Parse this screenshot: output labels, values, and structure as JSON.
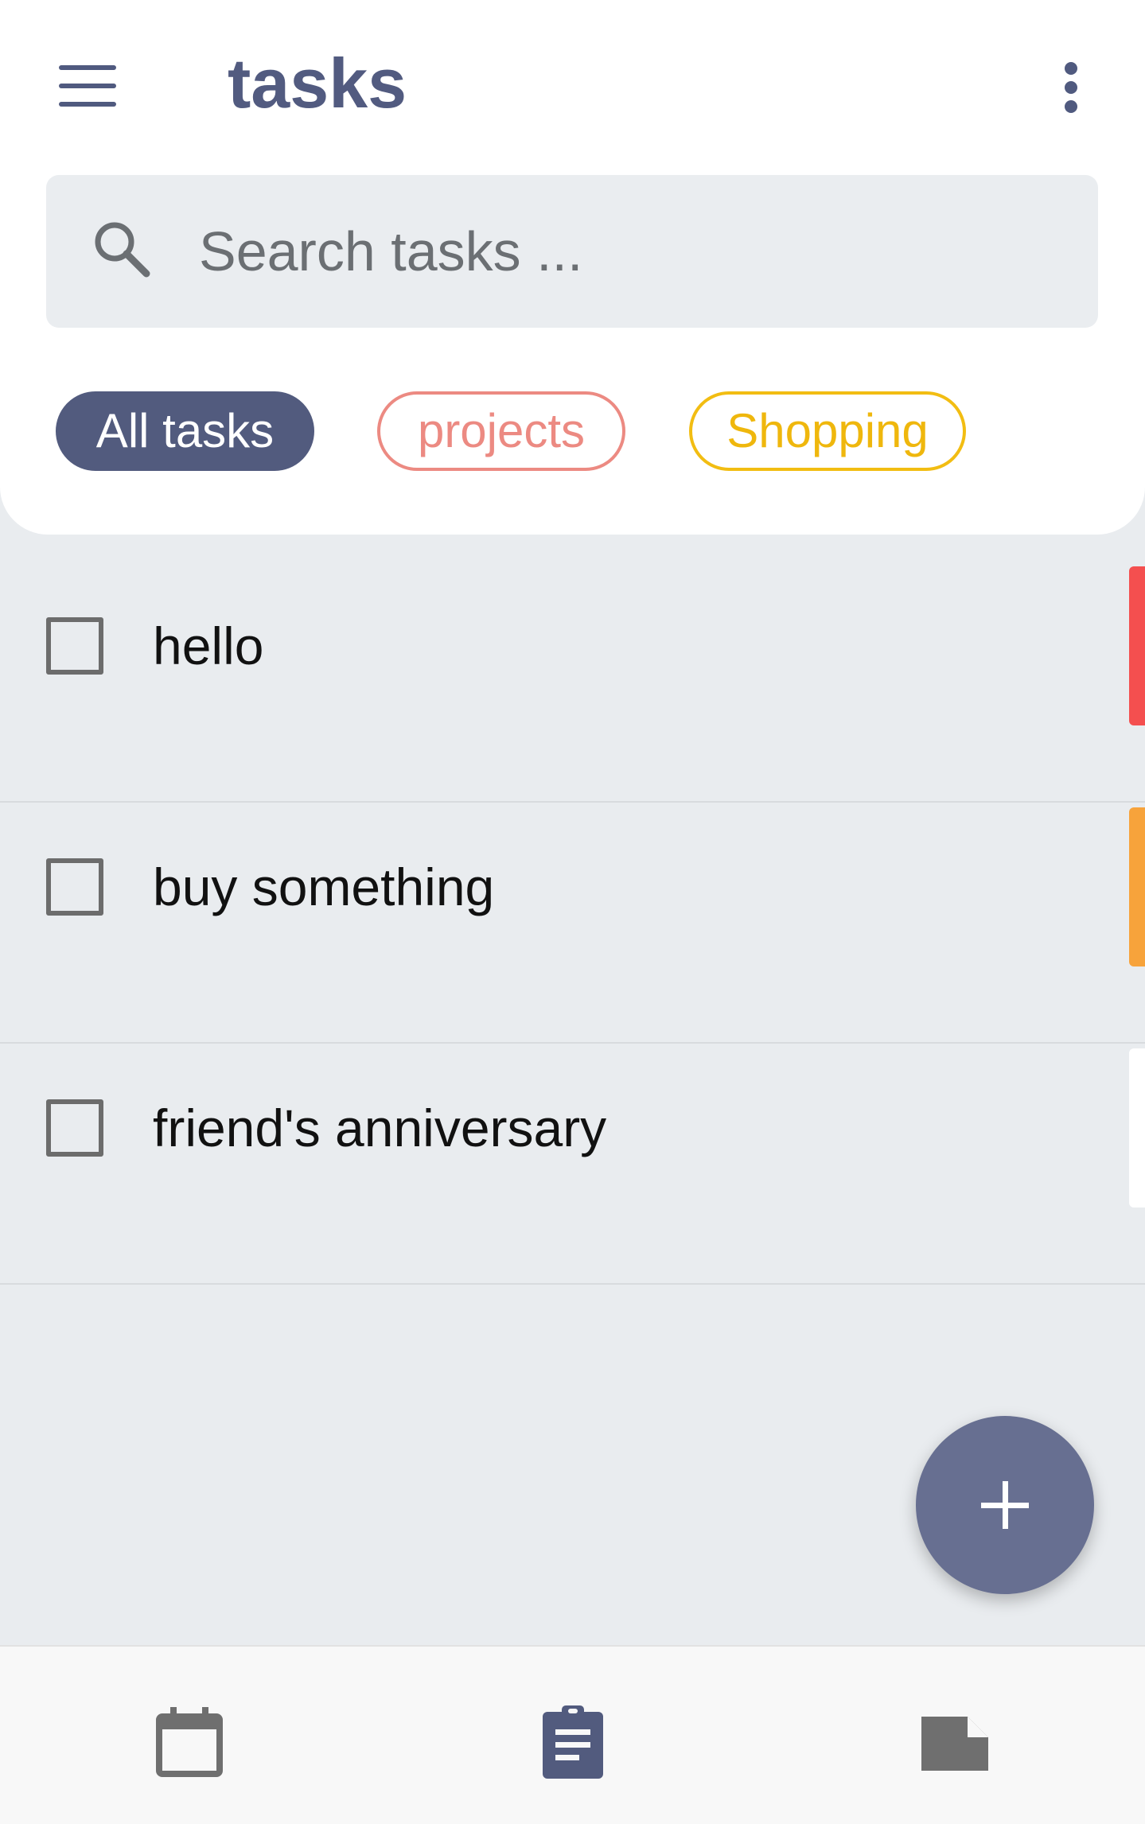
{
  "header": {
    "title": "tasks",
    "menu_icon": "hamburger-menu-icon",
    "more_icon": "more-vertical-icon"
  },
  "search": {
    "placeholder": "Search tasks ...",
    "value": "",
    "icon": "search-icon"
  },
  "filters": [
    {
      "label": "All tasks",
      "selected": true,
      "color": "#525b7e"
    },
    {
      "label": "projects",
      "selected": false,
      "color": "#ec8a82"
    },
    {
      "label": "Shopping",
      "selected": false,
      "color": "#f2bd12"
    }
  ],
  "tasks": [
    {
      "label": "hello",
      "checked": false,
      "priority_color": "#f44f4f"
    },
    {
      "label": "buy something",
      "checked": false,
      "priority_color": "#f7a33b"
    },
    {
      "label": "friend's anniversary",
      "checked": false,
      "priority_color": "#ffffff"
    }
  ],
  "fab": {
    "icon": "plus-icon"
  },
  "bottom_nav": [
    {
      "icon": "calendar-icon",
      "active": false
    },
    {
      "icon": "clipboard-list-icon",
      "active": true
    },
    {
      "icon": "note-icon",
      "active": false
    }
  ],
  "colors": {
    "accent": "#525b7e",
    "background": "#e9ecef"
  }
}
